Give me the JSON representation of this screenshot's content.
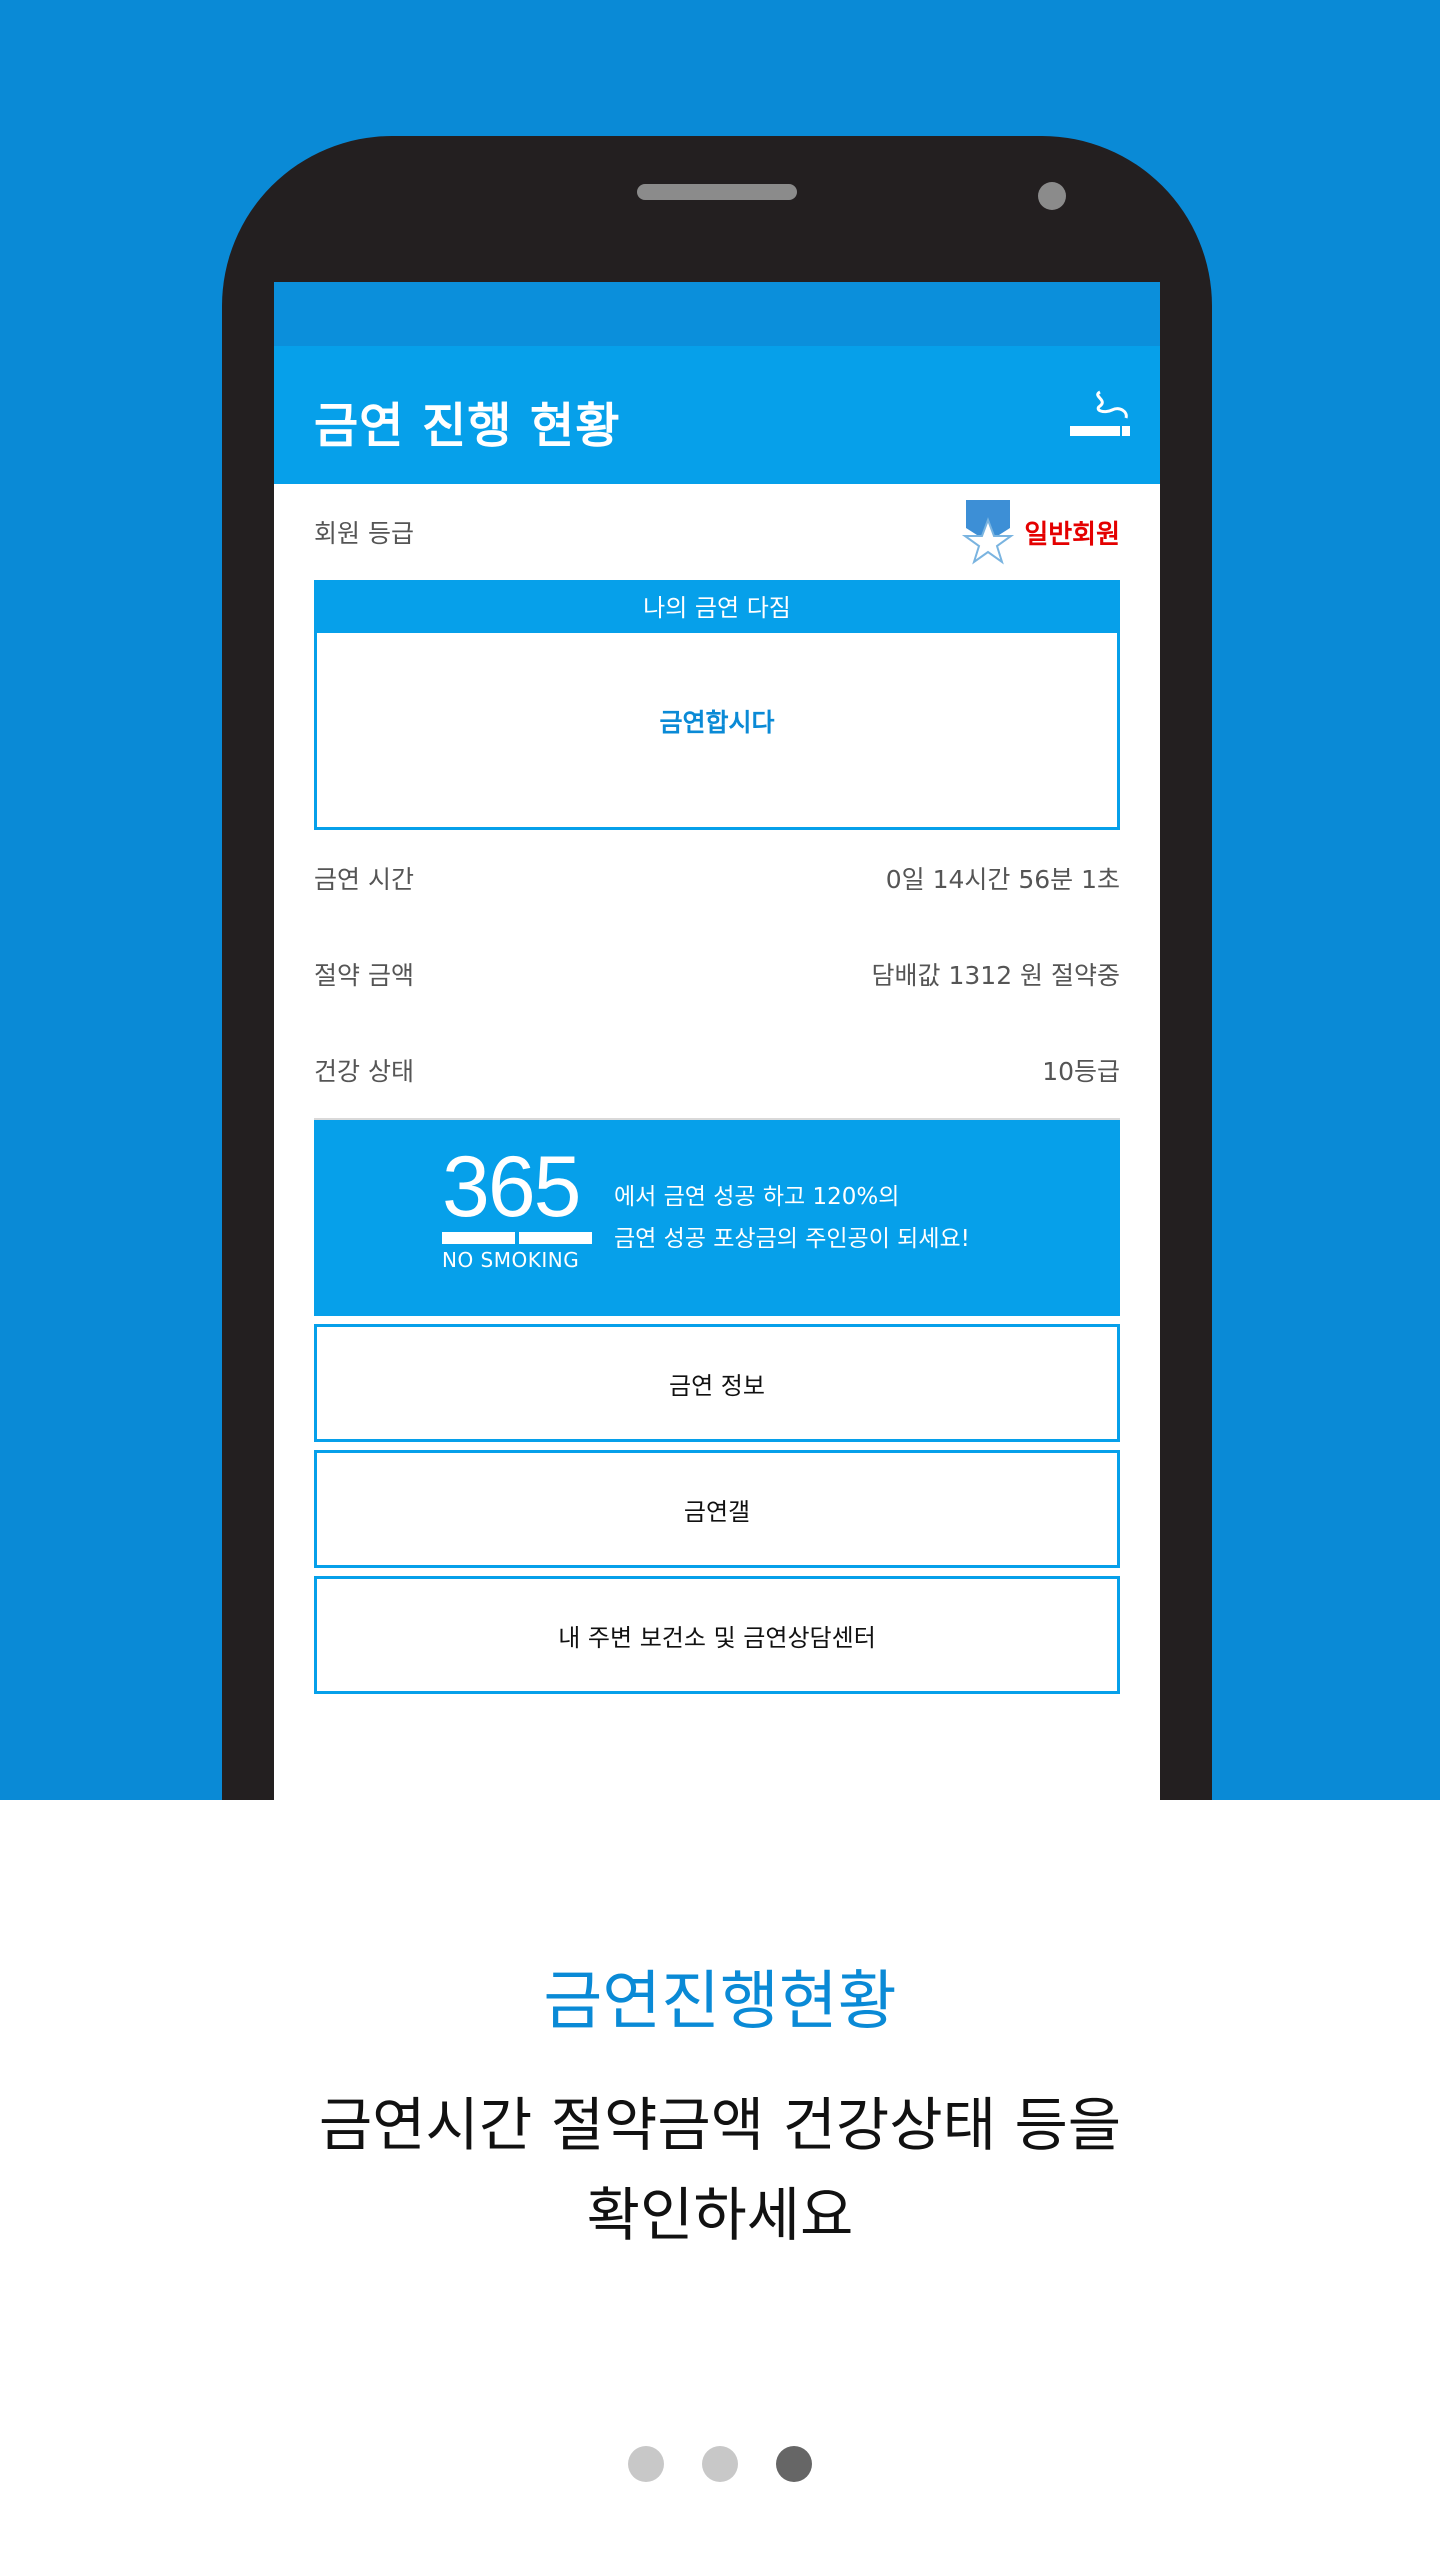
{
  "app": {
    "title": "금연 진행 현황",
    "member_grade_label": "회원 등급",
    "member_grade_value": "일반회원",
    "pledge": {
      "header": "나의 금연 다짐",
      "text": "금연합시다"
    },
    "stats": [
      {
        "label": "금연 시간",
        "value": "0일 14시간 56분 1초"
      },
      {
        "label": "절약 금액",
        "value": "담배값 1312 원 절약중"
      },
      {
        "label": "건강 상태",
        "value": "10등급"
      }
    ],
    "banner": {
      "logo_number": "365",
      "logo_sub": "NO SMOKING",
      "line1": "에서 금연 성공 하고 120%의",
      "line2": "금연 성공 포상금의 주인공이 되세요!"
    },
    "menu": [
      "금연 정보",
      "금연갤",
      "내 주변 보건소 및 금연상담센터"
    ],
    "nav_tabs": [
      {
        "icon": "list-icon",
        "active": true
      },
      {
        "icon": "grid-icon",
        "active": false
      },
      {
        "icon": "gear-icon",
        "active": false
      }
    ]
  },
  "caption": {
    "title": "금연진행현황",
    "line1": "금연시간 절약금액 건강상태 등을",
    "line2": "확인하세요"
  },
  "pager": {
    "count": 3,
    "active_index": 2
  },
  "colors": {
    "brand_blue": "#06a0ea",
    "hero_blue": "#0a8ad6",
    "grade_red": "#e40000",
    "phone_body": "#231f20"
  }
}
